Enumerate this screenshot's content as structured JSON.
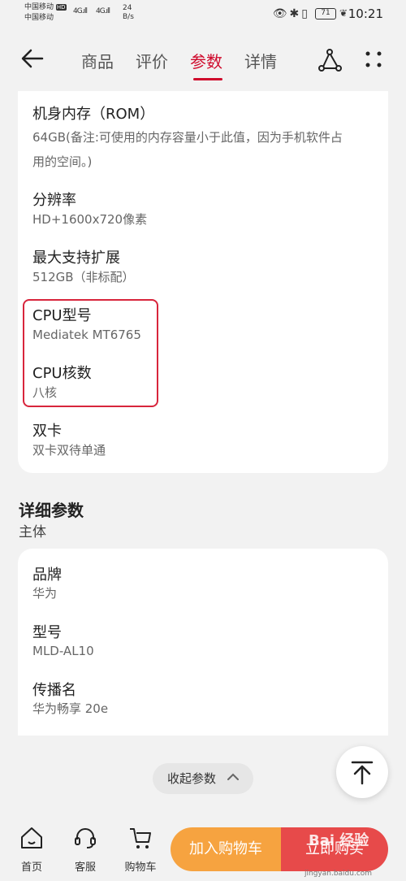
{
  "status_bar": {
    "carrier1": "中国移动",
    "carrier2": "中国移动",
    "hd": "HD",
    "signal1": "4G.ıll",
    "signal2": "4G.ıll",
    "net_rate_value": "24",
    "net_rate_unit": "B/s",
    "battery": "71",
    "time": "10:21"
  },
  "nav": {
    "tabs": [
      "商品",
      "评价",
      "参数",
      "详情"
    ],
    "active_tab": "参数"
  },
  "specs": [
    {
      "title": "机身内存（ROM）",
      "value_lines": [
        "64GB(备注:可使用的内存容量小于此值，因为手机软件占",
        "用的空间。)"
      ]
    },
    {
      "title": "分辨率",
      "value_lines": [
        "HD+1600x720像素"
      ]
    },
    {
      "title": "最大支持扩展",
      "value_lines": [
        "512GB（非标配）"
      ]
    },
    {
      "title": "CPU型号",
      "value_lines": [
        "Mediatek MT6765"
      ]
    },
    {
      "title": "CPU核数",
      "value_lines": [
        "八核"
      ]
    },
    {
      "title": "双卡",
      "value_lines": [
        "双卡双待单通"
      ]
    }
  ],
  "detail_section": {
    "title": "详细参数",
    "subtitle": "主体",
    "items": [
      {
        "title": "品牌",
        "value": "华为"
      },
      {
        "title": "型号",
        "value": "MLD-AL10"
      },
      {
        "title": "传播名",
        "value": "华为畅享 20e"
      }
    ]
  },
  "collapse_label": "收起参数",
  "bottom_bar": {
    "home": "首页",
    "service": "客服",
    "cart": "购物车",
    "add_to_cart": "加入购物车",
    "buy_now": "立即购买"
  },
  "watermark": {
    "text": "Bai 经验",
    "sub": "jingyan.baidu.com"
  },
  "colors": {
    "accent": "#cf0a2c",
    "cart_button": "#f6a340",
    "buy_button": "#e74a4a",
    "highlight_box": "#d8253c"
  }
}
